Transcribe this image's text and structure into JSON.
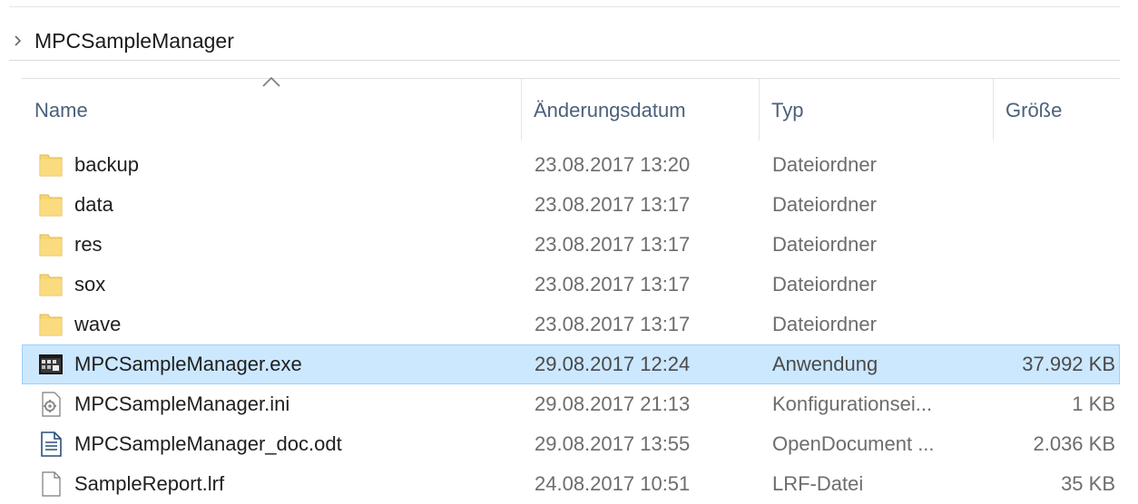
{
  "breadcrumb": {
    "items": [
      "MPCSampleManager"
    ]
  },
  "columns": {
    "name": "Name",
    "date": "Änderungsdatum",
    "type": "Typ",
    "size": "Größe"
  },
  "files": [
    {
      "name": "backup",
      "date": "23.08.2017 13:20",
      "type": "Dateiordner",
      "size": "",
      "icon": "folder-icon"
    },
    {
      "name": "data",
      "date": "23.08.2017 13:17",
      "type": "Dateiordner",
      "size": "",
      "icon": "folder-icon"
    },
    {
      "name": "res",
      "date": "23.08.2017 13:17",
      "type": "Dateiordner",
      "size": "",
      "icon": "folder-icon"
    },
    {
      "name": "sox",
      "date": "23.08.2017 13:17",
      "type": "Dateiordner",
      "size": "",
      "icon": "folder-icon"
    },
    {
      "name": "wave",
      "date": "23.08.2017 13:17",
      "type": "Dateiordner",
      "size": "",
      "icon": "folder-icon"
    },
    {
      "name": "MPCSampleManager.exe",
      "date": "29.08.2017 12:24",
      "type": "Anwendung",
      "size": "37.992 KB",
      "icon": "application-icon",
      "selected": true
    },
    {
      "name": "MPCSampleManager.ini",
      "date": "29.08.2017 21:13",
      "type": "Konfigurationsei...",
      "size": "1 KB",
      "icon": "settings-file-icon"
    },
    {
      "name": "MPCSampleManager_doc.odt",
      "date": "29.08.2017 13:55",
      "type": "OpenDocument ...",
      "size": "2.036 KB",
      "icon": "document-icon"
    },
    {
      "name": "SampleReport.lrf",
      "date": "24.08.2017 10:51",
      "type": "LRF-Datei",
      "size": "35 KB",
      "icon": "blank-file-icon"
    }
  ],
  "colors": {
    "selection_bg": "#cce8ff",
    "selection_border": "#99d1ff",
    "folder": "#f6d572",
    "header_text": "#4c607a"
  }
}
